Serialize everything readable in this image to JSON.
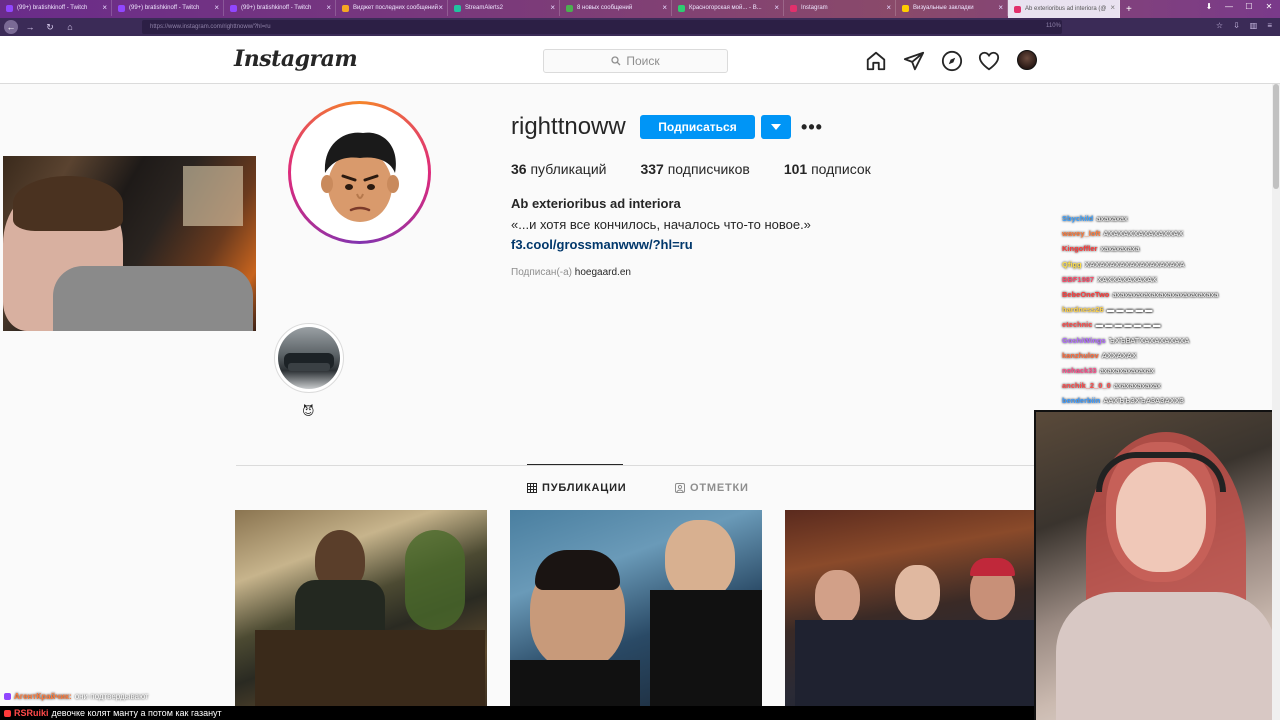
{
  "browser": {
    "tabs": [
      {
        "title": "(99+) bratishkinoff - Twitch",
        "color": "#9146ff"
      },
      {
        "title": "(99+) bratishkinoff - Twitch",
        "color": "#9146ff"
      },
      {
        "title": "(99+) bratishkinoff - Twitch",
        "color": "#9146ff"
      },
      {
        "title": "Виджет последних сообщений",
        "color": "#f5a623"
      },
      {
        "title": "StreamAlerts2",
        "color": "#21c2a0"
      },
      {
        "title": "8 новых сообщений",
        "color": "#4caf50"
      },
      {
        "title": "Красногорская мой... - В...",
        "color": "#2ecc71"
      },
      {
        "title": "Instagram",
        "color": "#e1306c"
      },
      {
        "title": "Визуальные закладки",
        "color": "#ffcc00"
      },
      {
        "title": "Ab exterioribus ad interiora (@",
        "color": "#e1306c"
      }
    ],
    "new_tab": "+",
    "url": "https://www.instagram.com/righttnoww/?hl=ru",
    "zoom": "110%"
  },
  "instagram": {
    "logo": "Instagram",
    "search_placeholder": "Поиск",
    "profile": {
      "username": "righttnoww",
      "follow_label": "Подписаться",
      "more_label": "•••",
      "stats": {
        "posts_count": "36",
        "posts_label": "публикаций",
        "followers_count": "337",
        "followers_label": "подписчиков",
        "following_count": "101",
        "following_label": "подписок"
      },
      "bio_name": "Ab exterioribus ad interiora",
      "bio_text": "«...и хотя все кончилось, началось что-то новое.»",
      "bio_link": "f3.cool/grossmanwww/?hl=ru",
      "followed_by_prefix": "Подписан(-а)",
      "followed_by_name": "hoegaard.en"
    },
    "highlight": {
      "label": "😈"
    },
    "tabs": {
      "posts": "ПУБЛИКАЦИИ",
      "tagged": "ОТМЕТКИ"
    }
  },
  "chat": [
    {
      "name": "Sbychild",
      "msg": "ахахахах",
      "color": "#3aa0ff"
    },
    {
      "name": "wavey_loft",
      "msg": "АХАХАХХАХАХАХХАХ",
      "color": "#ff7a3a"
    },
    {
      "name": "Kingoffler",
      "msg": "хахахахаха",
      "color": "#ff3a3a"
    },
    {
      "name": "Qfigg",
      "msg": "ХАХАХАХАХАХАХАХАХАХА",
      "color": "#ffe14a"
    },
    {
      "name": "BBF1987",
      "msg": "ХАХХАХАХАХАХ",
      "color": "#ff4a6a"
    },
    {
      "name": "BebeOneTwo",
      "msg": "ахахахахахахахахахахахахаха",
      "color": "#ff3a3a"
    },
    {
      "name": "hardness26",
      "msg": "▬ ▬ ▬ ▬ ▬",
      "color": "#ffd34a"
    },
    {
      "name": "etechnic",
      "msg": "▬ ▬ ▬ ▬ ▬ ▬ ▬",
      "color": "#ff4a4a"
    },
    {
      "name": "GoshiWings",
      "msg": "ЪХЪВАТХАХАХАХАХА",
      "color": "#b06aff"
    },
    {
      "name": "kanzhulov",
      "msg": "АХХАХАХ",
      "color": "#ff6a3a"
    },
    {
      "name": "nohack33",
      "msg": "ахахахахахахах",
      "color": "#ff4a8a"
    },
    {
      "name": "anchik_2_0_0",
      "msg": "ахахахахахах",
      "color": "#ff4a4a"
    },
    {
      "name": "benderbiin",
      "msg": "ААХЪЪЗХЪАЗАЗАХХЗ",
      "color": "#3a9aff"
    }
  ],
  "ticker": {
    "line1_name": "АгентКрайчик:",
    "line1_msg": "они подтвердывают",
    "line2_name": "RSRuiki",
    "line2_msg": "девочке колят манту а потом как газанут"
  }
}
